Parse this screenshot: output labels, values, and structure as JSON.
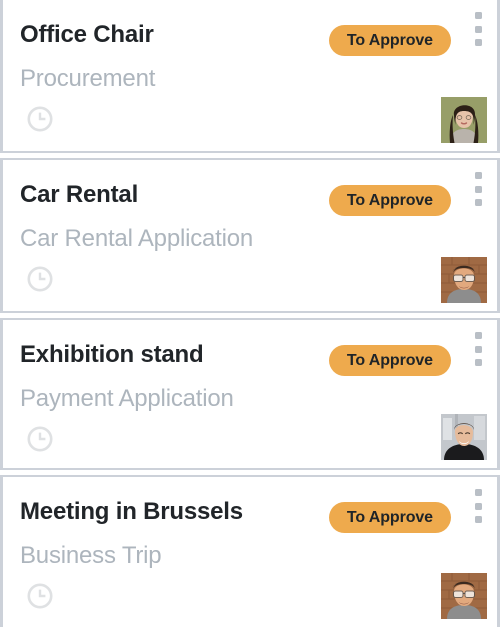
{
  "list": {
    "cards": [
      {
        "title": "Office Chair",
        "subtitle": "Procurement",
        "status": "To Approve",
        "clock_icon": "clock-icon",
        "menu_icon": "kebab-menu-icon",
        "avatar": {
          "name": "avatar-woman-dark-hair",
          "bg": "#9aa06a",
          "skin": "#e7c3aa",
          "hair": "#2c2017",
          "clothes": "#b9b3ab"
        }
      },
      {
        "title": "Car Rental",
        "subtitle": "Car Rental Application",
        "status": "To Approve",
        "clock_icon": "clock-icon",
        "menu_icon": "kebab-menu-icon",
        "avatar": {
          "name": "avatar-man-glasses-brick",
          "bg": "#a06a44",
          "skin": "#e2a97e",
          "hair": "#3b2a20",
          "clothes": "#8d8d8d"
        }
      },
      {
        "title": "Exhibition stand",
        "subtitle": "Payment Application",
        "status": "To Approve",
        "clock_icon": "clock-icon",
        "menu_icon": "kebab-menu-icon",
        "avatar": {
          "name": "avatar-man-dark-shirt",
          "bg": "#c3c7cc",
          "skin": "#e6bb9b",
          "hair": "#4a3a2e",
          "clothes": "#1b1b1d"
        }
      },
      {
        "title": "Meeting in Brussels",
        "subtitle": "Business Trip",
        "status": "To Approve",
        "clock_icon": "clock-icon",
        "menu_icon": "kebab-menu-icon",
        "avatar": {
          "name": "avatar-man-glasses-brick",
          "bg": "#a06a44",
          "skin": "#e2a97e",
          "hair": "#3b2a20",
          "clothes": "#8d8d8d"
        }
      }
    ]
  },
  "colors": {
    "badge_bg": "#eeaa4d",
    "badge_text": "#1f2428",
    "title": "#212529",
    "subtitle": "#adb5bd",
    "card_border": "#ccd1d9",
    "icon_gray": "#dfe1e3",
    "kebab_gray": "#b9bfc6"
  }
}
